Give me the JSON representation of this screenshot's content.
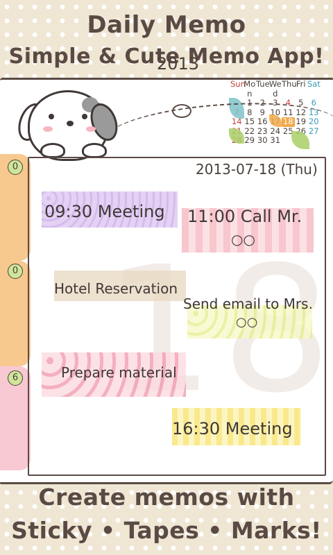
{
  "header": {
    "title": "Daily Memo",
    "subtitle": "Simple & Cute Memo App!"
  },
  "calendar": {
    "weekdays": [
      "Sun",
      "Mo n",
      "Tue",
      "We d",
      "Thu",
      "Fri",
      "Sat"
    ],
    "weekday_lines": [
      [
        "Sun",
        "Mo",
        "Tue",
        "We",
        "Thu",
        "Fri",
        "Sat"
      ],
      [
        "",
        "n",
        "",
        "d",
        "",
        "",
        ""
      ]
    ],
    "weeks": [
      [
        "",
        "1",
        "2",
        "3",
        "4",
        "5",
        "6"
      ],
      [
        "7",
        "8",
        "9",
        "10",
        "11",
        "12",
        "13"
      ],
      [
        "14",
        "15",
        "16",
        "17",
        "18",
        "19",
        "20"
      ],
      [
        "21",
        "22",
        "23",
        "24",
        "25",
        "26",
        "27"
      ],
      [
        "28",
        "29",
        "30",
        "31",
        "",
        "",
        ""
      ]
    ],
    "highlight_day": "18",
    "year": "2013"
  },
  "tabs": [
    {
      "count": "0",
      "color": "#f7c98f"
    },
    {
      "count": "0",
      "color": "#f7c98f"
    },
    {
      "count": "6",
      "color": "#f8c9d2"
    }
  ],
  "memo": {
    "date": "2013-07-18 (Thu)",
    "big_day": "18",
    "items": [
      {
        "text": "09:30 Meeting"
      },
      {
        "text": "11:00 Call Mr."
      },
      {
        "text": "○○"
      },
      {
        "text": "Hotel Reservation"
      },
      {
        "text": "Send email to Mrs."
      },
      {
        "text": "○○"
      },
      {
        "text": "Prepare material"
      },
      {
        "text": "16:30 Meeting"
      }
    ]
  },
  "footer": {
    "line1": "Create memos with",
    "line2": "Sticky • Tapes • Marks!"
  },
  "colors": {
    "background": "#efe6d4",
    "text": "#5a4a44",
    "tab_orange": "#f7c98f",
    "tab_pink": "#f8c9d2",
    "badge": "#cfe59a"
  }
}
